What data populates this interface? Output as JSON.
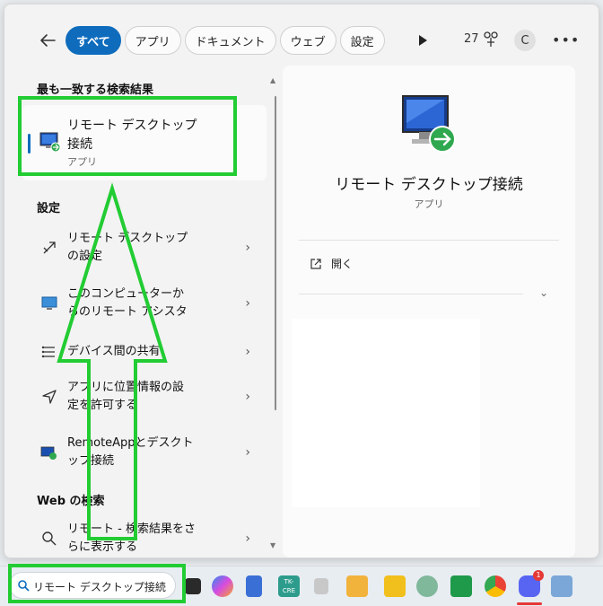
{
  "header": {
    "tabs": [
      {
        "label": "すべて",
        "active": true
      },
      {
        "label": "アプリ"
      },
      {
        "label": "ドキュメント"
      },
      {
        "label": "ウェブ"
      },
      {
        "label": "設定"
      }
    ],
    "points": "27",
    "avatar_initial": "C"
  },
  "best_match": {
    "title": "最も一致する検索結果",
    "name_line1": "リモート デスクトップ",
    "name_line2": "接続",
    "type": "アプリ"
  },
  "settings": {
    "title": "設定",
    "items": [
      {
        "line1": "リモート デスクトップ",
        "line2": "の設定",
        "icon": "remote-settings-icon"
      },
      {
        "line1": "このコンピューターか",
        "line2": "らのリモート アシスタ",
        "icon": "monitor-icon"
      },
      {
        "line1": "デバイス間の共有",
        "line2": "",
        "icon": "share-icon"
      },
      {
        "line1": "アプリに位置情報の設",
        "line2": "定を許可する",
        "icon": "location-icon"
      },
      {
        "line1": "RemoteAppとデスクト",
        "line2": "ップ接続",
        "icon": "remoteapp-icon"
      }
    ]
  },
  "web": {
    "title": "Web の検索",
    "item_line1": "リモート - 検索結果をさ",
    "item_line2": "らに表示する"
  },
  "detail": {
    "app_name": "リモート デスクトップ接続",
    "app_type": "アプリ",
    "open_label": "開く"
  },
  "taskbar": {
    "search_value": "リモート デスクトップ接続",
    "tk_label_1": "TK-",
    "tk_label_2": "CRE",
    "badge": "1"
  },
  "colors": {
    "accent": "#0f6cbd",
    "annotation": "#22cc33"
  }
}
